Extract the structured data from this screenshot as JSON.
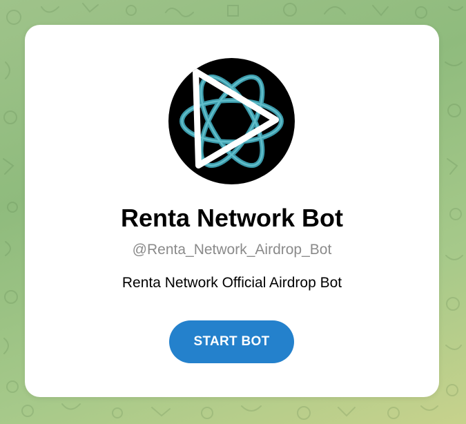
{
  "bot": {
    "name": "Renta Network Bot",
    "username": "@Renta_Network_Airdrop_Bot",
    "description": "Renta Network Official Airdrop Bot",
    "start_label": "START BOT"
  },
  "colors": {
    "background_start": "#9fc38a",
    "background_end": "#c7d28c",
    "card": "#ffffff",
    "accent": "#2481cc",
    "avatar_bg": "#000000",
    "logo_teal": "#3fa3b4",
    "logo_white": "#ffffff",
    "username_gray": "#8a8a8a"
  },
  "icons": {
    "avatar": "renta-logo-icon",
    "background": "doodle-pattern"
  }
}
